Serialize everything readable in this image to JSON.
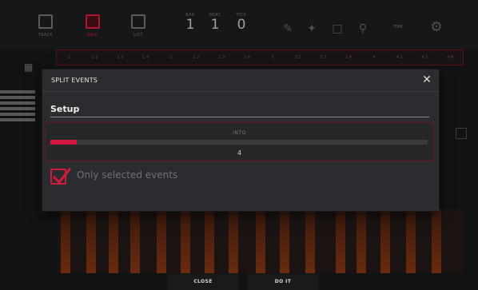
{
  "toolbar": {
    "buttons": [
      {
        "caption": "TRACK",
        "icon": "track-icon"
      },
      {
        "caption": "GRID",
        "icon": "grid-mode-icon"
      },
      {
        "caption": "LIST",
        "icon": "list-icon"
      }
    ],
    "counters": [
      {
        "label": "BAR",
        "value": "1"
      },
      {
        "label": "BEAT",
        "value": "1"
      },
      {
        "label": "TICK",
        "value": "0"
      }
    ],
    "tools": [
      "pencil-icon",
      "eraser-select-icon",
      "selection-box-icon",
      "zoom-icon"
    ],
    "mode_label": "TIME",
    "settings_icon": "gear-icon"
  },
  "ruler": {
    "ticks": [
      "1",
      "1.2",
      "1.3",
      "1.4",
      "2",
      "2.2",
      "2.3",
      "2.4",
      "3",
      "3.2",
      "3.3",
      "3.4",
      "4",
      "4.2",
      "4.3",
      "4.4"
    ]
  },
  "dialog": {
    "title": "SPLIT EVENTS",
    "close_icon": "close-icon",
    "section": "Setup",
    "into": {
      "label": "INTO",
      "value": "4",
      "fill_fraction": 0.07
    },
    "checkbox": {
      "label": "Only selected events",
      "checked": true
    }
  },
  "footer": {
    "close_label": "CLOSE",
    "doit_label": "DO IT"
  },
  "colors": {
    "accent": "#d5163f",
    "background": "#111214",
    "dialog": "#2b2c2f"
  }
}
